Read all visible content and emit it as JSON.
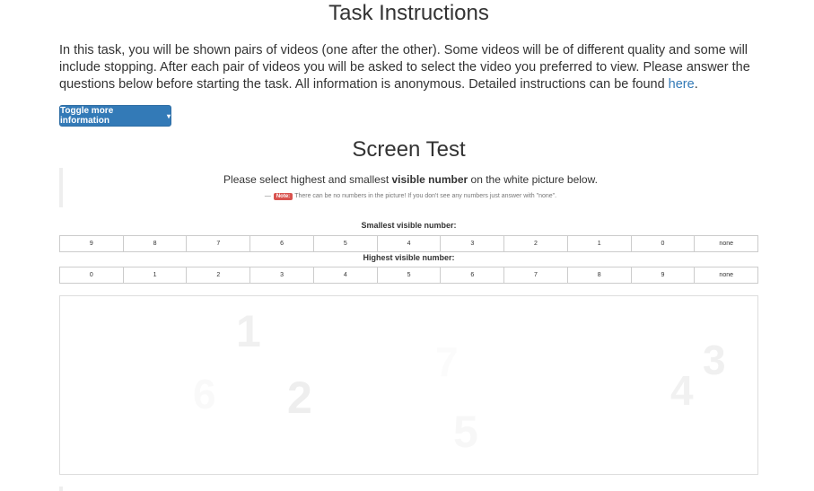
{
  "header": {
    "title": "Task Instructions"
  },
  "intro": {
    "text": "In this task, you will be shown pairs of videos (one after the other). Some videos will be of different quality and some will include stopping. After each pair of videos you will be asked to select the video you preferred to view. Please answer the questions below before starting the task. All information is anonymous. Detailed instructions can be found ",
    "link_text": "here",
    "end": "."
  },
  "toggle": {
    "label": "Toggle more information",
    "caret": "▾"
  },
  "screen_test": {
    "title": "Screen Test",
    "prompt_before": "Please select highest and smallest ",
    "prompt_bold": "visible number",
    "prompt_after": " on the white picture below.",
    "note_dash": "—",
    "note_badge": "Note:",
    "note_text": "There can be no numbers in the picture! If you don't see any numbers just answer with \"none\"."
  },
  "smallest": {
    "label": "Smallest visible number:",
    "options": [
      "9",
      "8",
      "7",
      "6",
      "5",
      "4",
      "3",
      "2",
      "1",
      "0",
      "none"
    ]
  },
  "highest": {
    "label": "Highest visible number:",
    "options": [
      "0",
      "1",
      "2",
      "3",
      "4",
      "5",
      "6",
      "7",
      "8",
      "9",
      "none"
    ]
  },
  "test_picture": {
    "numbers": [
      "1",
      "2",
      "6",
      "7",
      "5",
      "4",
      "3"
    ]
  },
  "colors": {
    "accent": "#337ab7",
    "note_badge": "#d9534f"
  }
}
